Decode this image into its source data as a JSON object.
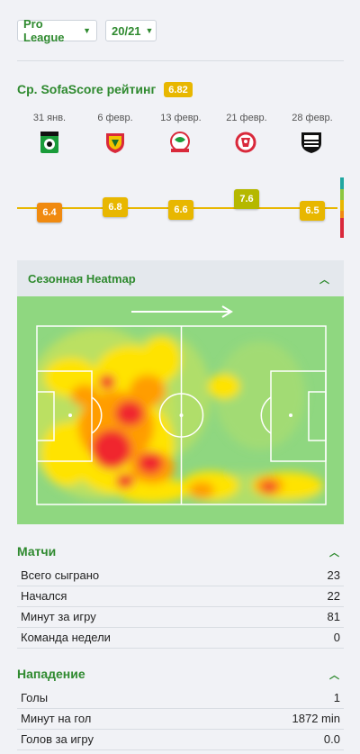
{
  "filters": {
    "league": "Pro League",
    "season": "20/21"
  },
  "rating": {
    "title": "Ср. SofaScore рейтинг",
    "average": "6.82",
    "matches": [
      {
        "date": "31 янв.",
        "rating": "6.4",
        "color": "#f08a10",
        "logo": "cercle-brugge-logo"
      },
      {
        "date": "6 февр.",
        "rating": "6.8",
        "color": "#e8b700",
        "logo": "kv-oostende-logo"
      },
      {
        "date": "13 февр.",
        "rating": "6.6",
        "color": "#e8b700",
        "logo": "zulte-waregem-logo"
      },
      {
        "date": "21 февр.",
        "rating": "7.6",
        "color": "#b5b800",
        "logo": "antwerp-logo"
      },
      {
        "date": "28 февр.",
        "rating": "6.5",
        "color": "#e8b700",
        "logo": "eupen-logo"
      }
    ],
    "scale_colors": [
      "#20a7a0",
      "#8cc63f",
      "#e8b700",
      "#f08a10",
      "#d9293b"
    ]
  },
  "heatmap": {
    "title": "Сезонная Heatmap"
  },
  "matches_section": {
    "title": "Матчи",
    "rows": [
      {
        "label": "Всего сыграно",
        "value": "23"
      },
      {
        "label": "Начался",
        "value": "22"
      },
      {
        "label": "Минут за игру",
        "value": "81"
      },
      {
        "label": "Команда недели",
        "value": "0"
      }
    ]
  },
  "attack_section": {
    "title": "Нападение",
    "rows": [
      {
        "label": "Голы",
        "value": "1"
      },
      {
        "label": "Минут на гол",
        "value": "1872 min"
      },
      {
        "label": "Голов за игру",
        "value": "0.0"
      }
    ]
  }
}
